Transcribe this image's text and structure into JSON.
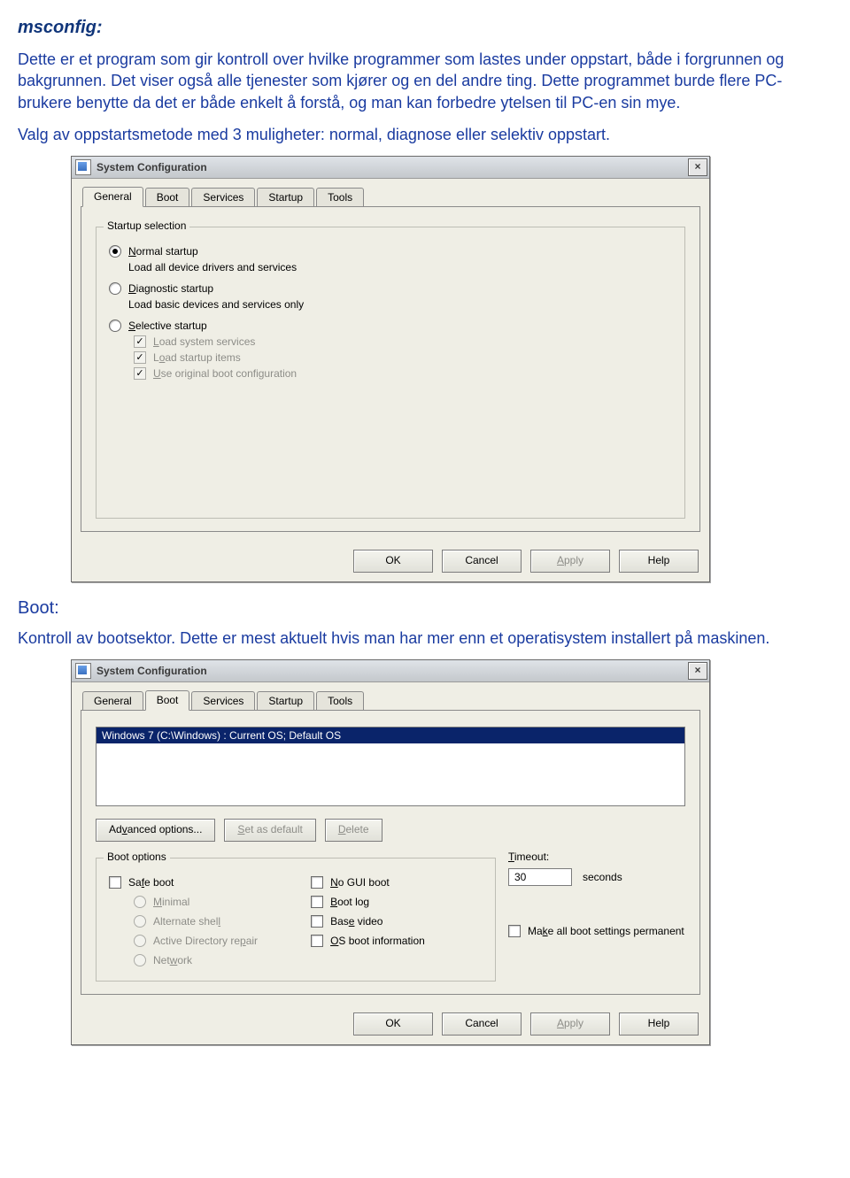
{
  "doc": {
    "heading": "msconfig:",
    "p1": "Dette er et program som gir kontroll over hvilke programmer som lastes under oppstart, både i forgrunnen og bakgrunnen. Det viser også alle tjenester som kjører og en del andre ting. Dette programmet burde flere PC-brukere benytte da det er både enkelt å forstå, og man kan forbedre ytelsen til PC-en sin mye.",
    "p2": "Valg av oppstartsmetode med 3 muligheter: normal, diagnose eller selektiv oppstart.",
    "boot_title": "Boot:",
    "p3": "Kontroll av bootsektor. Dette er mest aktuelt hvis man har mer enn et operatisystem installert på maskinen."
  },
  "dialog": {
    "title": "System Configuration",
    "tabs": {
      "general": "General",
      "boot": "Boot",
      "services": "Services",
      "startup": "Startup",
      "tools": "Tools"
    },
    "buttons": {
      "ok": "OK",
      "cancel": "Cancel",
      "apply": "Apply",
      "help": "Help"
    }
  },
  "general": {
    "legend": "Startup selection",
    "normal": "Normal startup",
    "normal_sub": "Load all device drivers and services",
    "diag": "Diagnostic startup",
    "diag_sub": "Load basic devices and services only",
    "selective": "Selective startup",
    "load_services": "Load system services",
    "load_startup": "Load startup items",
    "use_original": "Use original boot configuration"
  },
  "boot": {
    "os_item": "Windows 7 (C:\\Windows) : Current OS; Default OS",
    "advanced": "Advanced options...",
    "set_default": "Set as default",
    "delete": "Delete",
    "options_legend": "Boot options",
    "safe_boot": "Safe boot",
    "minimal": "Minimal",
    "alt_shell": "Alternate shell",
    "ad_repair": "Active Directory repair",
    "network": "Network",
    "no_gui": "No GUI boot",
    "boot_log": "Boot log",
    "base_video": "Base video",
    "os_info": "OS boot information",
    "timeout_label": "Timeout:",
    "timeout_value": "30",
    "seconds": "seconds",
    "make_permanent": "Make all boot settings permanent"
  }
}
